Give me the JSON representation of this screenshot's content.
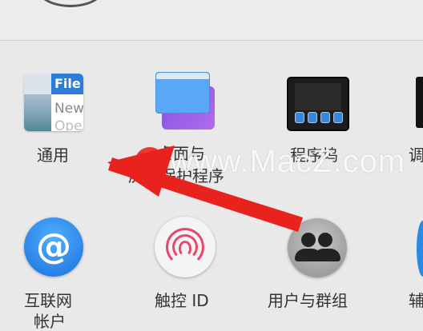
{
  "panes": {
    "general": {
      "label": "通用",
      "icon_word1": "File",
      "icon_word2": "New",
      "icon_word3": "Ope"
    },
    "desktop": {
      "label_line1": "桌面与",
      "label_line2": "屏幕保护程序"
    },
    "mission": {
      "label": "程序坞"
    },
    "partial_right_top": {
      "label": "调"
    },
    "internet_accounts": {
      "label_line1": "互联网",
      "label_line2": "帐户",
      "icon_glyph": "@"
    },
    "touch_id": {
      "label": "触控 ID"
    },
    "users_groups": {
      "label": "用户与群组"
    },
    "partial_right_bottom": {
      "label": "辅"
    }
  },
  "watermark": {
    "logo_letter": "Z",
    "text": "www.MacZ.com"
  },
  "annotation": {
    "arrow_color": "#e8231e"
  }
}
